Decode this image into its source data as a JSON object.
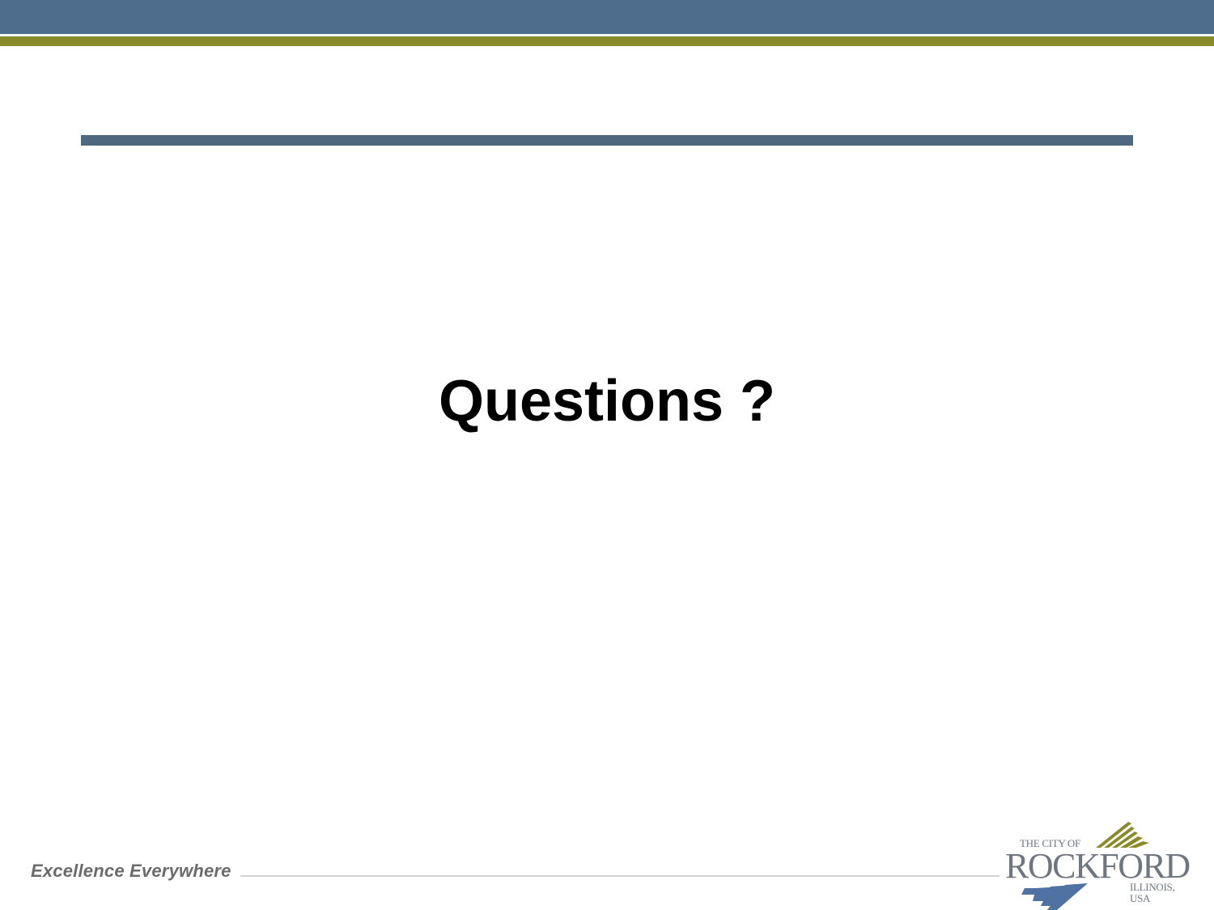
{
  "slide": {
    "main_text": "Questions ?"
  },
  "footer": {
    "tagline": "Excellence Everywhere",
    "logo": {
      "top_text": "THE CITY OF",
      "name": "ROCKFORD",
      "bottom_text": "ILLINOIS, USA"
    }
  },
  "colors": {
    "top_band": "#4e6d8c",
    "olive_accent": "#8a8a2a",
    "title_rule": "#4e6880",
    "text": "#000000",
    "tagline": "#6b6b6b",
    "logo_gray": "#6f7680",
    "logo_blue": "#4f72a3"
  }
}
